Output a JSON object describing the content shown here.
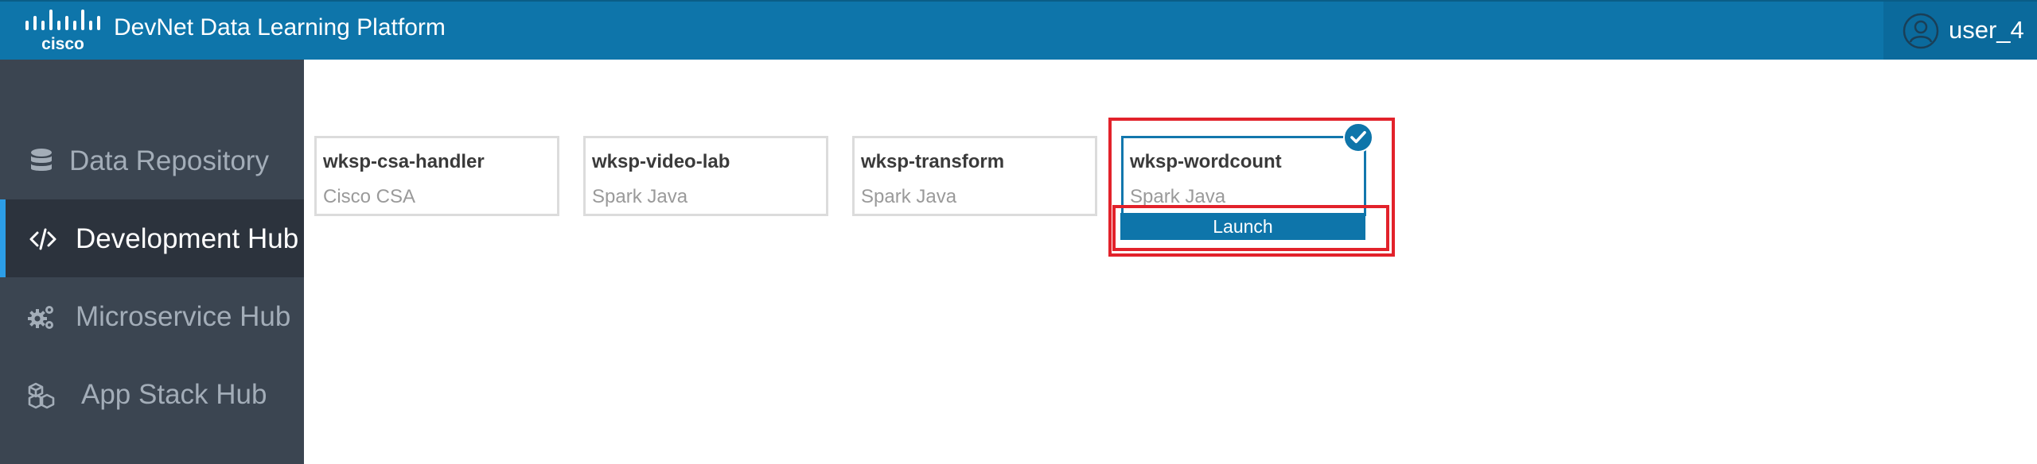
{
  "header": {
    "brand": "cisco",
    "title": "DevNet Data Learning Platform",
    "user": "user_4"
  },
  "sidebar": {
    "items": [
      {
        "label": "Data Repository",
        "icon": "database-icon",
        "active": false
      },
      {
        "label": "Development Hub",
        "icon": "code-icon",
        "active": true
      },
      {
        "label": "Microservice Hub",
        "icon": "gears-icon",
        "active": false
      },
      {
        "label": "App Stack Hub",
        "icon": "cubes-icon",
        "active": false
      }
    ]
  },
  "workspaces": [
    {
      "name": "wksp-csa-handler",
      "type": "Cisco CSA",
      "selected": false
    },
    {
      "name": "wksp-video-lab",
      "type": "Spark Java",
      "selected": false
    },
    {
      "name": "wksp-transform",
      "type": "Spark Java",
      "selected": false
    },
    {
      "name": "wksp-wordcount",
      "type": "Spark Java",
      "selected": true
    }
  ],
  "launch_label": "Launch",
  "colors": {
    "header_bg": "#0e75aa",
    "sidebar_bg": "#3b4551",
    "active_indicator": "#2c9ee8",
    "highlight": "#e2222b"
  }
}
